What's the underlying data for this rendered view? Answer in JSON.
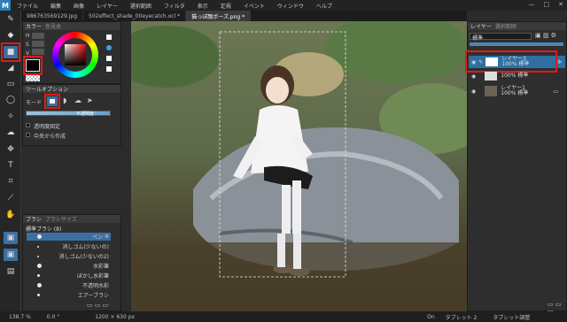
{
  "menu": {
    "items": [
      "ファイル",
      "編集",
      "画像",
      "レイヤー",
      "選択範囲",
      "フィルタ",
      "表示",
      "定規",
      "イベント",
      "ウィンドウ",
      "ヘルプ"
    ],
    "window_controls": [
      "—",
      "□",
      "✕"
    ]
  },
  "tabs": [
    {
      "label": "986763569129.jpg",
      "active": false
    },
    {
      "label": "502effect_shade_00eyecatch.ocl *",
      "active": false
    },
    {
      "label": "猫っぽ顔ボーズ.png *",
      "active": true
    }
  ],
  "color_panel": {
    "title": "カラー",
    "subtitle": "色見本",
    "hsv_labels": [
      "H",
      "S",
      "V"
    ],
    "foreground": "#000000",
    "background": "#ffffff"
  },
  "tool_option": {
    "title": "ツールオプション",
    "mode_label": "モード",
    "opacity_label": "不透明度",
    "checkbox1": "透明度固定",
    "checkbox2": "中央から作成"
  },
  "brush_panel": {
    "tabs": [
      "ブラシ",
      "ブラシサイズ"
    ],
    "group": "標準ブラシ (8)",
    "items": [
      "ペン",
      "消しゴム(少ないの)",
      "消しゴム(少ないの2)",
      "水彩筆",
      "ぼかし水彩筆",
      "不透明水彩",
      "エアーブラシ"
    ]
  },
  "layer_panel": {
    "tabs": [
      "レイヤー",
      "選択範囲"
    ],
    "blend_mode": "標準",
    "layers": [
      {
        "name": "レイヤー3",
        "info": "100% 標準",
        "selected": true
      },
      {
        "name": "",
        "info": "100% 標準",
        "selected": false
      },
      {
        "name": "レイヤー1",
        "info": "100% 標準",
        "selected": false
      }
    ]
  },
  "status": {
    "zoom": "138.7 %",
    "angle": "0.0 °",
    "size": "1200 × 630 px",
    "on_label": "On",
    "tablet1": "タブレット 2",
    "tablet2": "タブレット調整"
  }
}
